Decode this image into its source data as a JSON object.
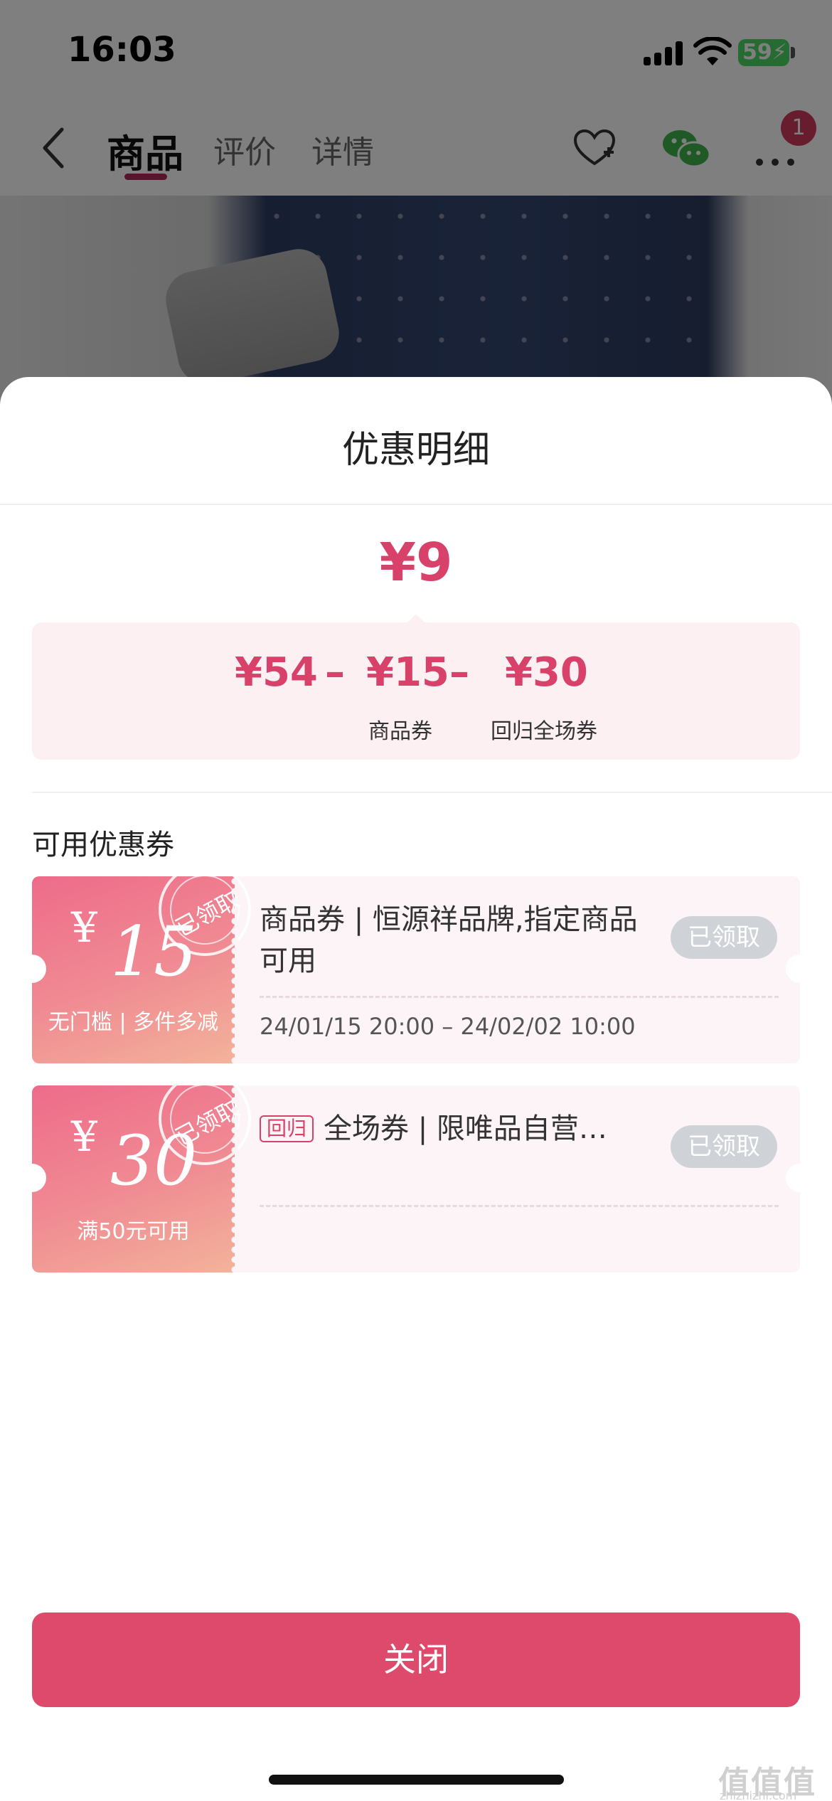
{
  "status_bar": {
    "time": "16:03",
    "battery": "59"
  },
  "nav": {
    "tabs": [
      {
        "label": "商品",
        "active": true
      },
      {
        "label": "评价",
        "active": false
      },
      {
        "label": "详情",
        "active": false
      }
    ],
    "cart_badge": "1",
    "icons": [
      "back-icon",
      "favorite-add-icon",
      "wechat-icon",
      "more-icon"
    ]
  },
  "sheet": {
    "title": "优惠明细",
    "final_price": "¥9",
    "calculation": {
      "original": "¥54",
      "op1": "–",
      "discount1": "¥15",
      "discount1_label": "商品券",
      "op2": "–",
      "discount2": "¥30",
      "discount2_label": "回归全场券"
    },
    "section_title": "可用优惠券",
    "coupons": [
      {
        "currency": "¥",
        "amount": "15",
        "condition": "无门槛 | 多件多减",
        "stamp": "已领取",
        "tag": "",
        "title": "商品券 | 恒源祥品牌,指定商品可用",
        "validity": "24/01/15 20:00 – 24/02/02 10:00",
        "status": "已领取"
      },
      {
        "currency": "¥",
        "amount": "30",
        "condition": "满50元可用",
        "stamp": "已领取",
        "tag": "回归",
        "title": "全场券 | 限唯品自营…",
        "validity": "",
        "status": "已领取"
      }
    ],
    "close_label": "关闭"
  },
  "watermark": {
    "main": "值值值",
    "sub": "zhizhizhi.com"
  },
  "colors": {
    "accent": "#d8416a",
    "button": "#de4a6b",
    "coupon_bg": "#fcf4f6",
    "claimed": "#cfd3d8"
  }
}
